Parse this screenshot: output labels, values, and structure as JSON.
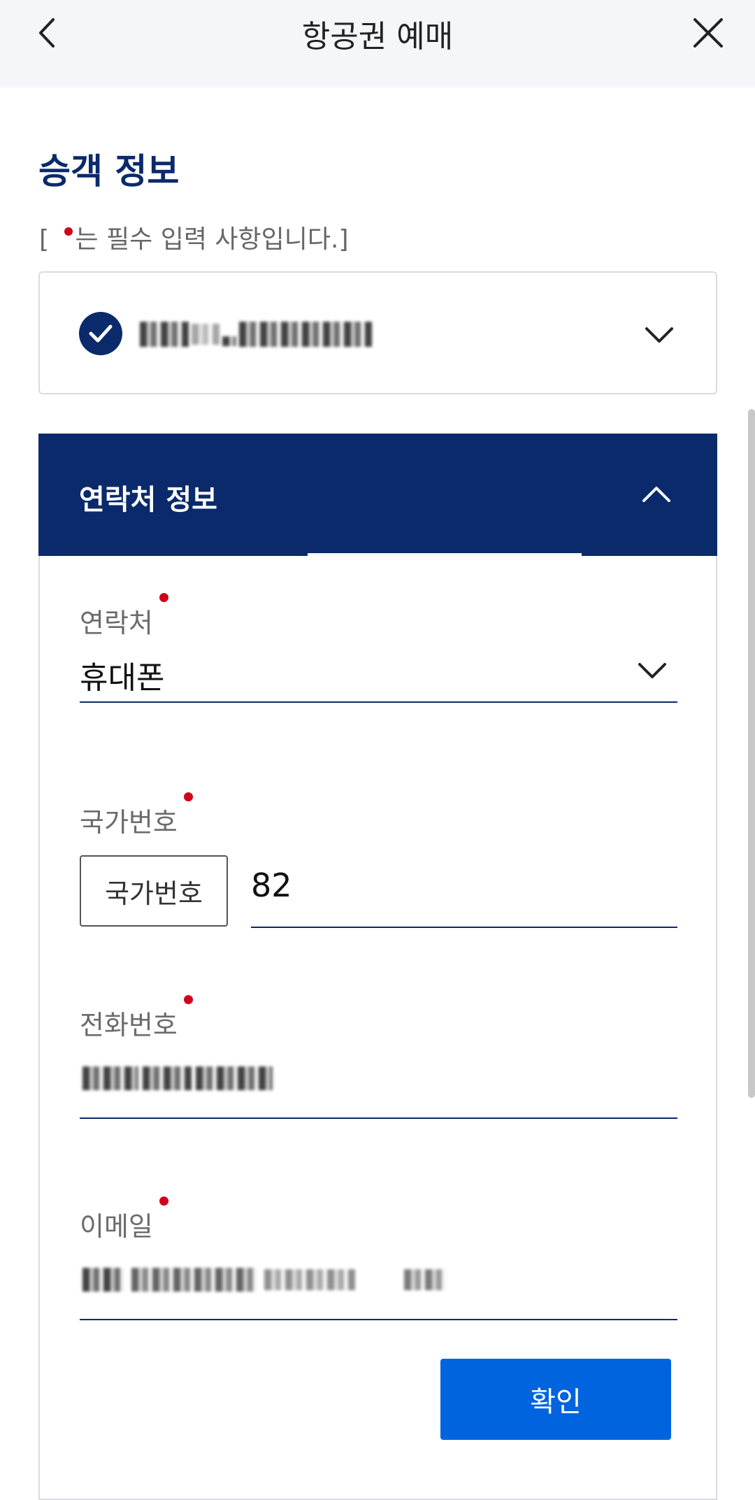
{
  "header": {
    "title": "항공권 예매",
    "back_icon": "chevron-left-icon",
    "close_icon": "close-icon"
  },
  "section": {
    "title": "승객 정보",
    "required_note_prefix": "[ ",
    "required_note_suffix": "는 필수 입력 사항입니다.]"
  },
  "passenger": {
    "name": "(blurred)",
    "status_icon": "check-circle-icon",
    "expand_icon": "chevron-down-icon"
  },
  "contact": {
    "header_label": "연락처 정보",
    "collapse_icon": "chevron-up-icon",
    "fields": {
      "contact_type": {
        "label": "연락처",
        "value": "휴대폰"
      },
      "country_code": {
        "label": "국가번호",
        "button_label": "국가번호",
        "value": "82"
      },
      "phone": {
        "label": "전화번호",
        "value": "(blurred)"
      },
      "email": {
        "label": "이메일",
        "value": "(blurred)"
      }
    },
    "confirm_label": "확인"
  },
  "colors": {
    "navy": "#0b2a6b",
    "primary_button": "#0064de",
    "required_dot": "#d0021b",
    "topbar_bg": "#f5f6fa"
  }
}
